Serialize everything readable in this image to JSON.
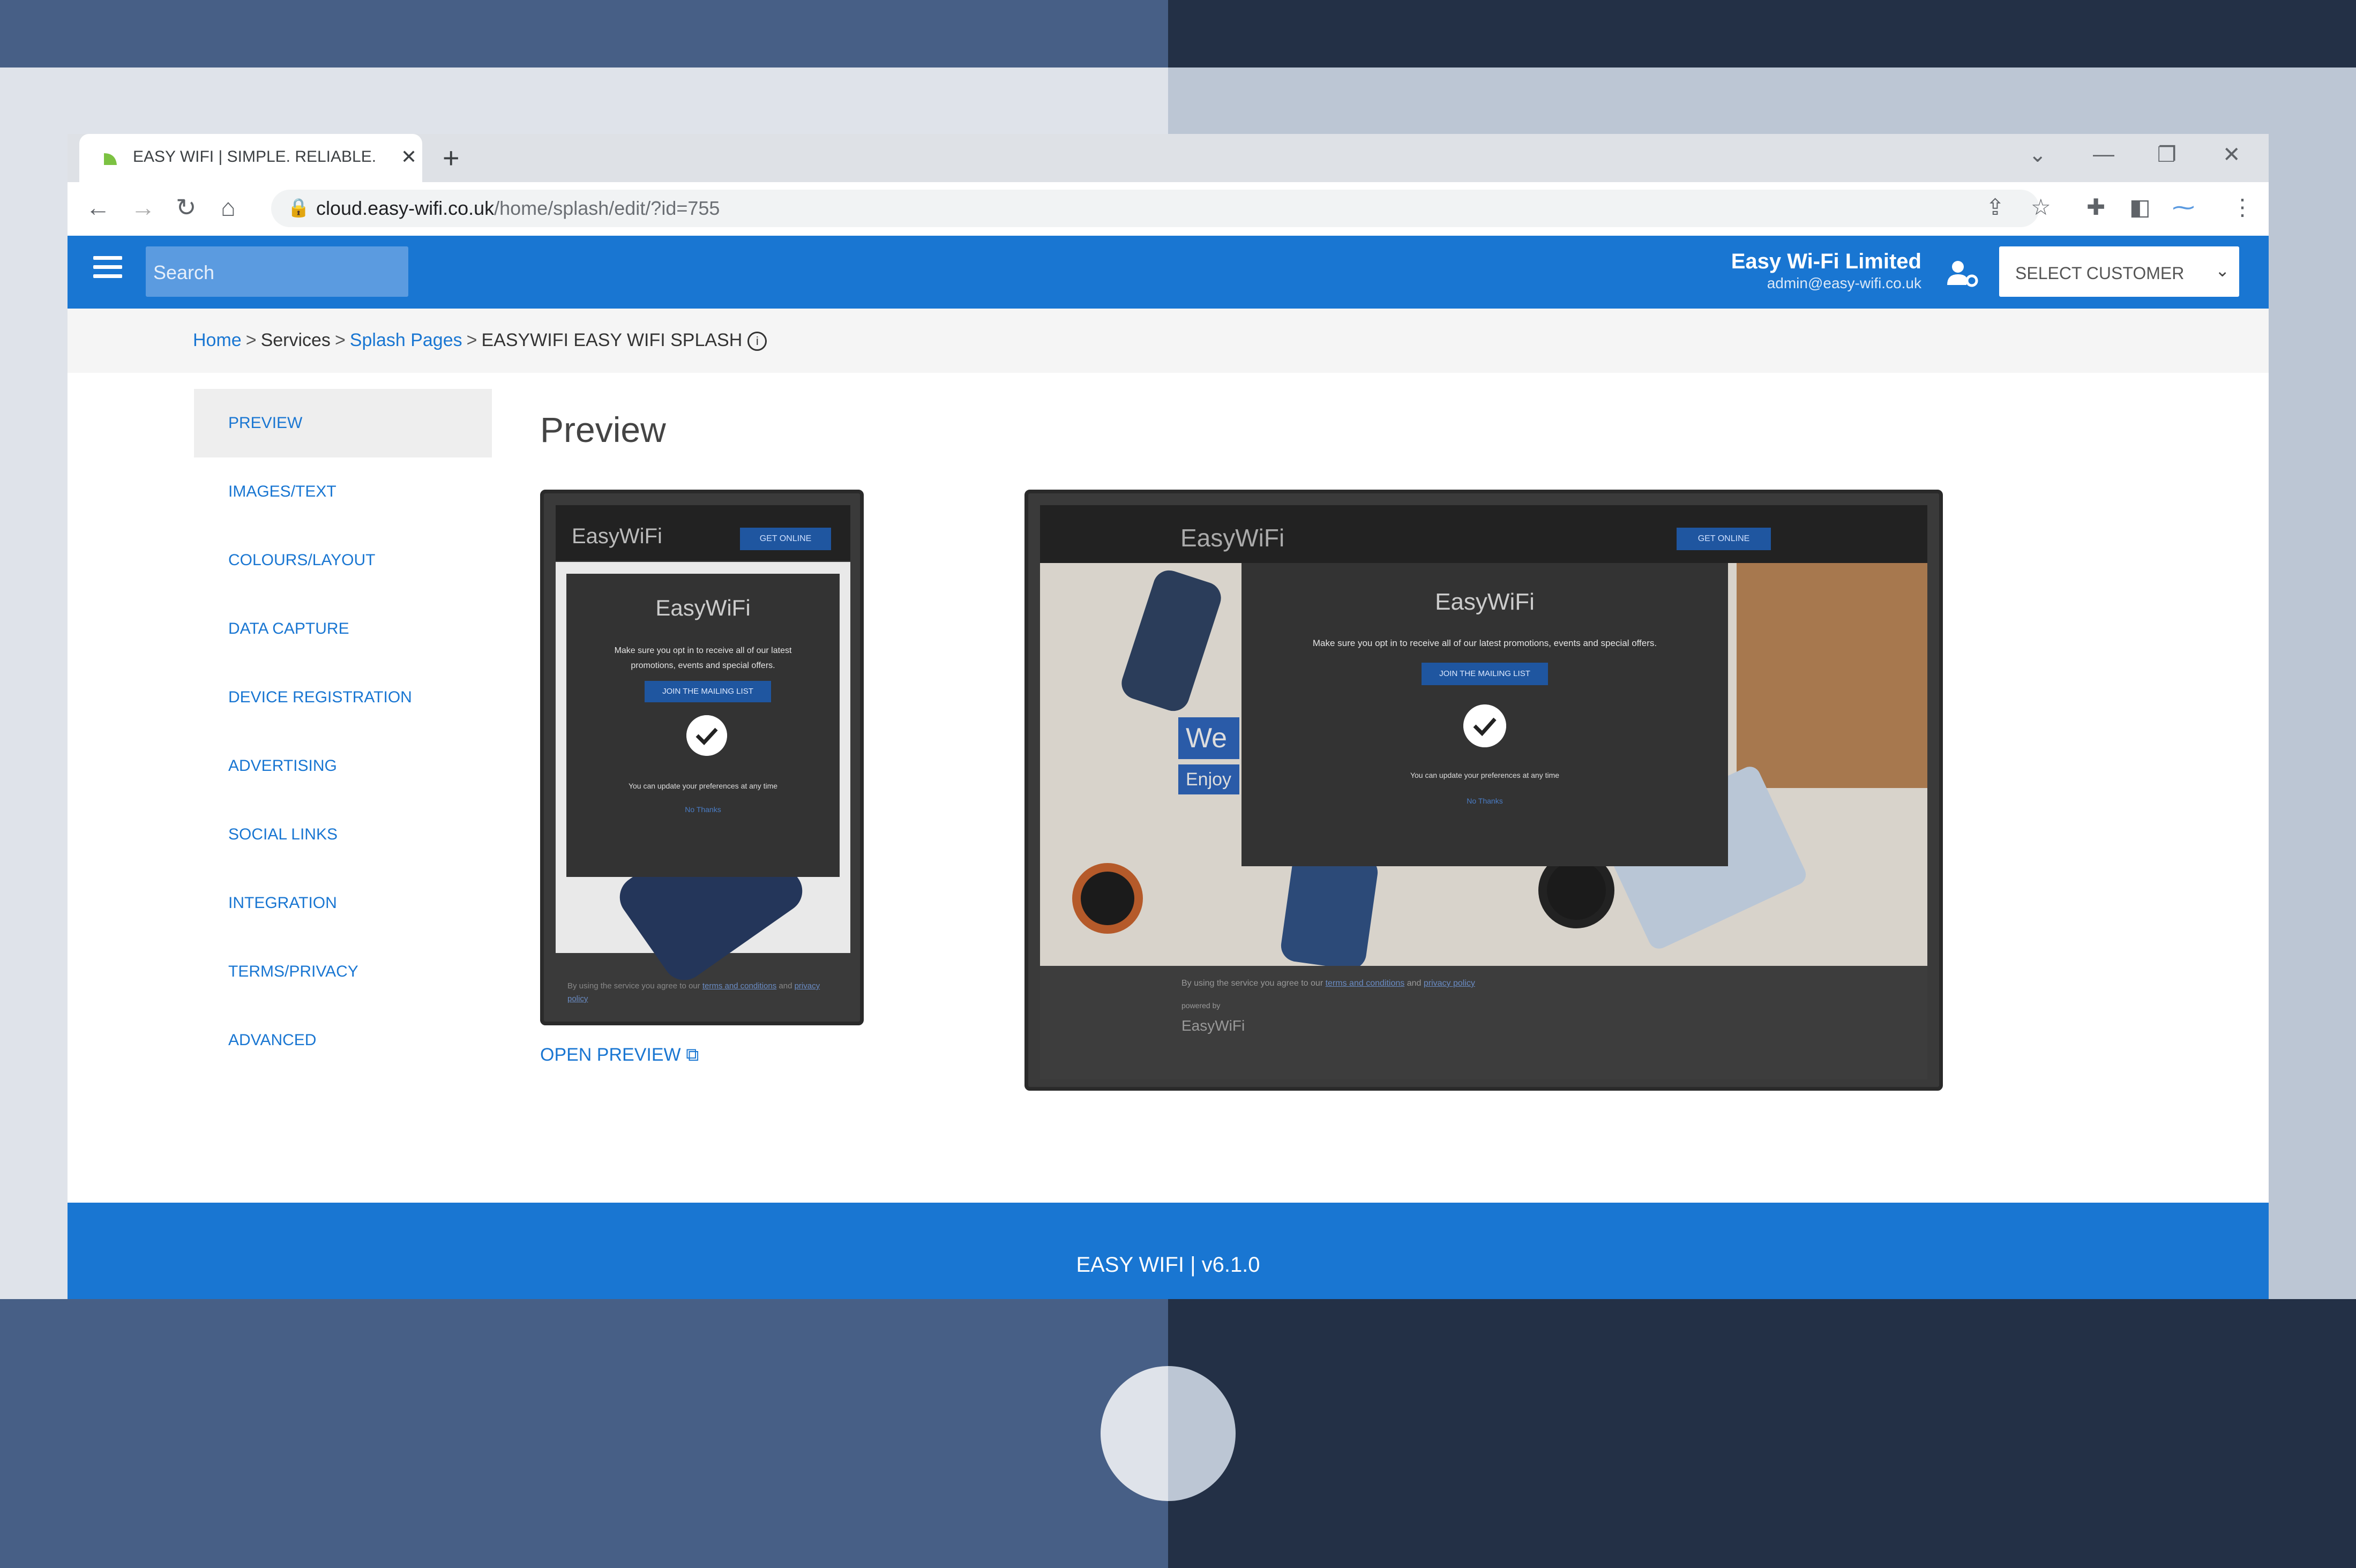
{
  "browser": {
    "tab_title": "EASY WIFI | SIMPLE. RELIABLE. SI",
    "url_host": "cloud.easy-wifi.co.uk",
    "url_path": "/home/splash/edit/?id=755"
  },
  "header": {
    "search_placeholder": "Search",
    "company_name": "Easy Wi-Fi Limited",
    "company_email": "admin@easy-wifi.co.uk",
    "select_customer": "SELECT CUSTOMER"
  },
  "breadcrumb": {
    "home": "Home",
    "services": "Services",
    "splash_pages": "Splash Pages",
    "current": "EASYWIFI EASY WIFI SPLASH",
    "separator": ">"
  },
  "sidenav": {
    "items": [
      {
        "label": "PREVIEW"
      },
      {
        "label": "IMAGES/TEXT"
      },
      {
        "label": "COLOURS/LAYOUT"
      },
      {
        "label": "DATA CAPTURE"
      },
      {
        "label": "DEVICE REGISTRATION"
      },
      {
        "label": "ADVERTISING"
      },
      {
        "label": "SOCIAL LINKS"
      },
      {
        "label": "INTEGRATION"
      },
      {
        "label": "TERMS/PRIVACY"
      },
      {
        "label": "ADVANCED"
      }
    ]
  },
  "main": {
    "heading": "Preview",
    "open_preview": "OPEN PREVIEW"
  },
  "splash": {
    "logo": "EasyWiFi",
    "get_online": "GET ONLINE",
    "message": "Make sure you opt in to receive all of our latest promotions, events and special offers.",
    "join_button": "JOIN THE MAILING LIST",
    "update_note": "You can update your preferences at any time",
    "no_thanks": "No Thanks",
    "welcome": "We",
    "enjoy": "Enjoy",
    "terms_text": "By using the service you agree to our",
    "terms_link": "terms and conditions",
    "and": "and",
    "privacy_link": "privacy policy",
    "powered_by": "powered by"
  },
  "footer": {
    "text": "EASY WIFI | v6.1.0"
  },
  "colors": {
    "brand_blue": "#1976d2",
    "splash_dark": "#333333"
  }
}
